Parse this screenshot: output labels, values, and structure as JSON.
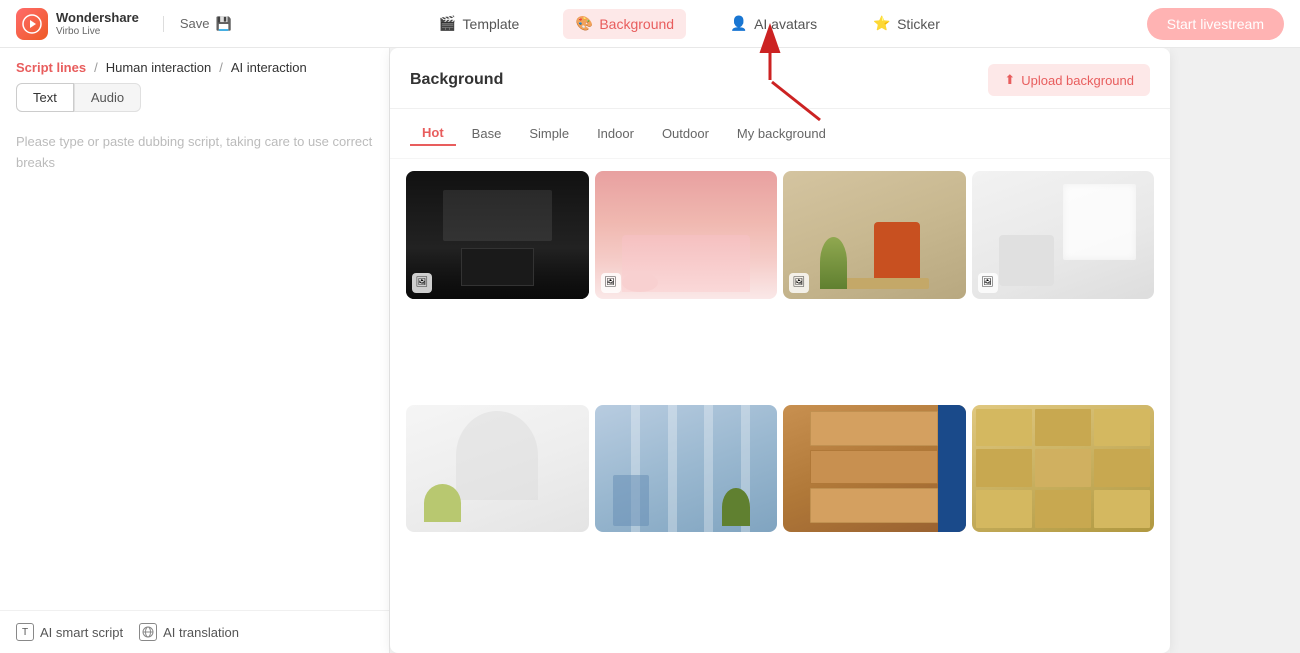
{
  "logo": {
    "brand": "Wondershare",
    "product": "Virbo Live"
  },
  "topnav": {
    "save_label": "Save",
    "items": [
      {
        "id": "template",
        "label": "Template",
        "icon": "🎬",
        "active": false
      },
      {
        "id": "background",
        "label": "Background",
        "icon": "🎨",
        "active": true
      },
      {
        "id": "ai-avatars",
        "label": "AI avatars",
        "icon": "👤",
        "active": false
      },
      {
        "id": "sticker",
        "label": "Sticker",
        "icon": "⭐",
        "active": false
      }
    ],
    "start_label": "Start livestream"
  },
  "left_panel": {
    "nav_items": [
      {
        "id": "script-lines",
        "label": "Script lines",
        "active": true
      },
      {
        "id": "human-interaction",
        "label": "Human interaction",
        "active": false
      },
      {
        "id": "ai-interaction",
        "label": "AI interaction",
        "active": false
      }
    ],
    "tabs": [
      {
        "id": "text",
        "label": "Text",
        "active": true
      },
      {
        "id": "audio",
        "label": "Audio",
        "active": false
      }
    ],
    "placeholder": "Please type or paste dubbing script, taking care to use correct breaks",
    "bottom_tools": [
      {
        "id": "ai-smart-script",
        "label": "AI smart script"
      },
      {
        "id": "ai-translation",
        "label": "AI translation"
      }
    ]
  },
  "background_panel": {
    "title": "Background",
    "upload_label": "Upload background",
    "categories": [
      {
        "id": "hot",
        "label": "Hot",
        "active": true
      },
      {
        "id": "base",
        "label": "Base",
        "active": false
      },
      {
        "id": "simple",
        "label": "Simple",
        "active": false
      },
      {
        "id": "indoor",
        "label": "Indoor",
        "active": false
      },
      {
        "id": "outdoor",
        "label": "Outdoor",
        "active": false
      },
      {
        "id": "my-background",
        "label": "My background",
        "active": false
      }
    ],
    "items": [
      {
        "id": "kitchen",
        "style": "kitchen",
        "has_icon": true
      },
      {
        "id": "bedroom",
        "style": "bedroom",
        "has_icon": true
      },
      {
        "id": "living-room",
        "style": "living",
        "has_icon": true
      },
      {
        "id": "white-room",
        "style": "white-room",
        "has_icon": true
      },
      {
        "id": "arch",
        "style": "arch",
        "has_icon": false
      },
      {
        "id": "office",
        "style": "office",
        "has_icon": false
      },
      {
        "id": "warehouse1",
        "style": "warehouse1",
        "has_icon": false
      },
      {
        "id": "warehouse2",
        "style": "warehouse2",
        "has_icon": false
      }
    ]
  },
  "arrow": {
    "visible": true
  }
}
